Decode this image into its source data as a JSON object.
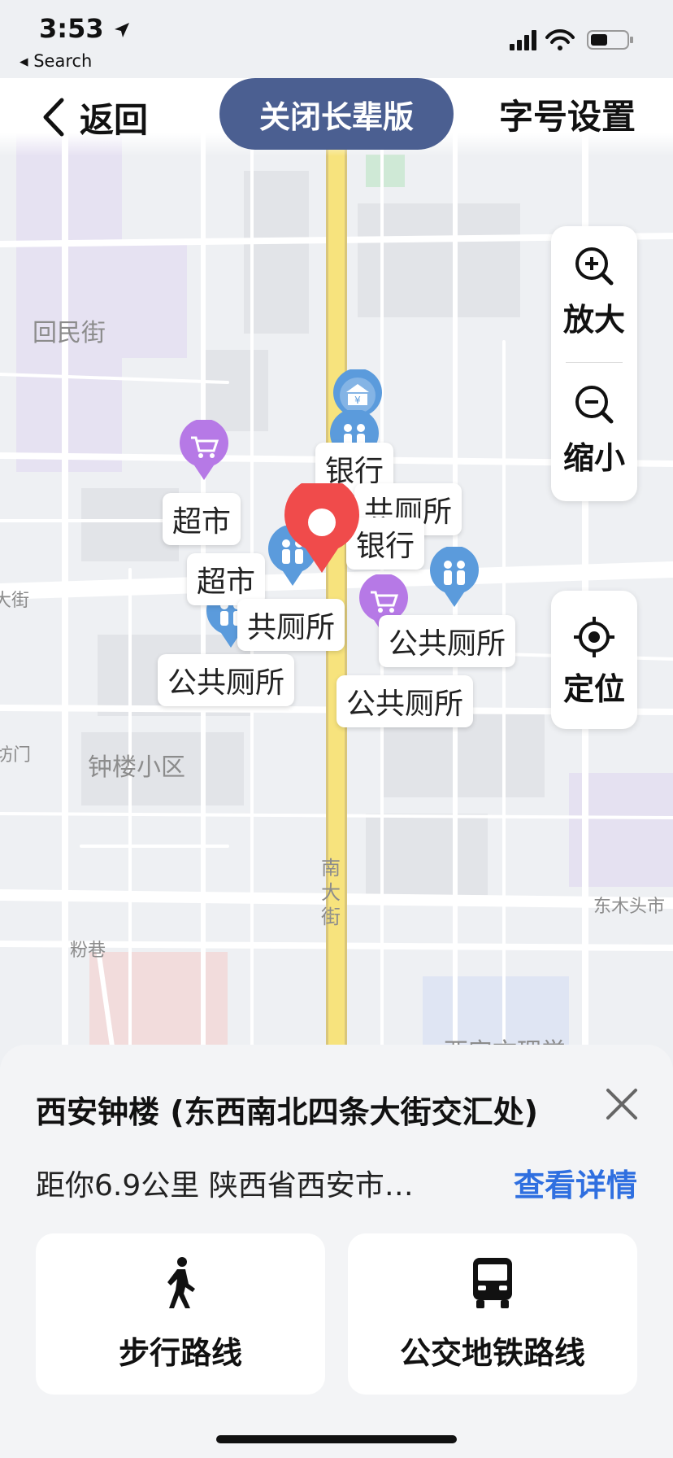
{
  "status_bar": {
    "time": "3:53",
    "back_app": "◂ Search"
  },
  "topbar": {
    "back_label": "返回",
    "elder_button": "关闭长辈版",
    "font_button": "字号设置"
  },
  "map_controls": {
    "zoom_in": "放大",
    "zoom_out": "缩小",
    "locate": "定位"
  },
  "map_labels": {
    "huiminjie": "回民街",
    "zhonglou_xiaoqu": "钟楼小区",
    "dong_mu_tou_shi": "东木头市",
    "fen_xiang": "粉巷",
    "nan_da_jie": "南大街",
    "da_jie_left": "大街",
    "fang_men": "坊门",
    "bottom_partial": "西安文理学"
  },
  "poi_labels": {
    "bank_1": "银行",
    "bank_2": "银行",
    "toilet_1": "共厕所",
    "supermarket_1": "超市",
    "supermarket_2": "超市",
    "toilet_2": "共厕所",
    "toilet_3": "公共厕所",
    "toilet_4": "公共厕所",
    "toilet_5": "公共厕所"
  },
  "place": {
    "title": "西安钟楼 (东西南北四条大街交汇处)",
    "distance_address": "距你6.9公里 陕西省西安市…",
    "detail_link": "查看详情"
  },
  "routes": {
    "walk": "步行路线",
    "transit": "公交地铁路线"
  },
  "colors": {
    "accent_blue": "#2f6fe0",
    "elder_button_bg": "#4b5f91",
    "pin_red": "#f04b4b",
    "poi_blue": "#5b9bdc",
    "poi_purple": "#b679e6"
  }
}
